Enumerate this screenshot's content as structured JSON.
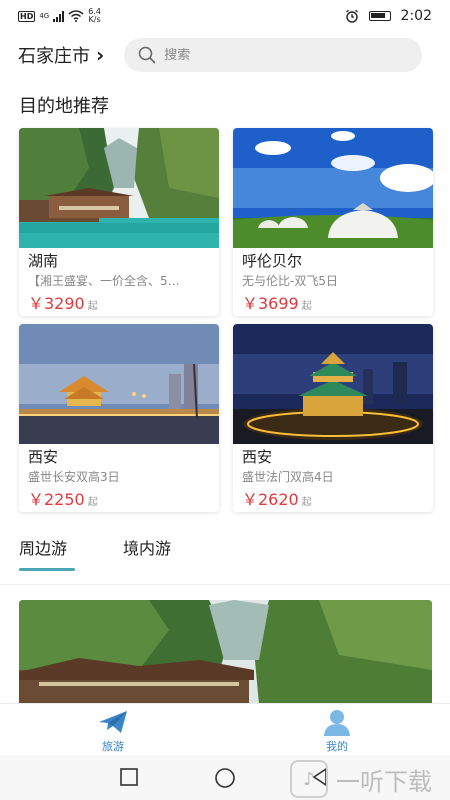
{
  "status_bar": {
    "network": "HD",
    "signal": "4G",
    "speed_value": "6.4",
    "speed_unit": "K/s",
    "time": "2:02"
  },
  "header": {
    "city": "石家庄市",
    "search_placeholder": "搜索"
  },
  "section_title": "目的地推荐",
  "destinations": [
    {
      "title": "湖南",
      "desc": "【湘王盛宴、一价全含、5…",
      "price": "￥3290",
      "unit": "起"
    },
    {
      "title": "呼伦贝尔",
      "desc": "无与伦比-双飞5日",
      "price": "￥3699",
      "unit": "起"
    },
    {
      "title": "西安",
      "desc": "盛世长安双高3日",
      "price": "￥2250",
      "unit": "起"
    },
    {
      "title": "西安",
      "desc": "盛世法门双高4日",
      "price": "￥2620",
      "unit": "起"
    }
  ],
  "tabs": [
    {
      "label": "周边游",
      "active": true
    },
    {
      "label": "境内游",
      "active": false
    }
  ],
  "bottom_nav": [
    {
      "label": "旅游",
      "icon": "plane-icon",
      "active": true
    },
    {
      "label": "我的",
      "icon": "person-icon",
      "active": false
    }
  ],
  "watermark": "一听下载",
  "colors": {
    "accent": "#4aa7b3",
    "price": "#e0393e",
    "nav_active": "#3a86c8",
    "nav_inactive": "#7cb8e6"
  }
}
